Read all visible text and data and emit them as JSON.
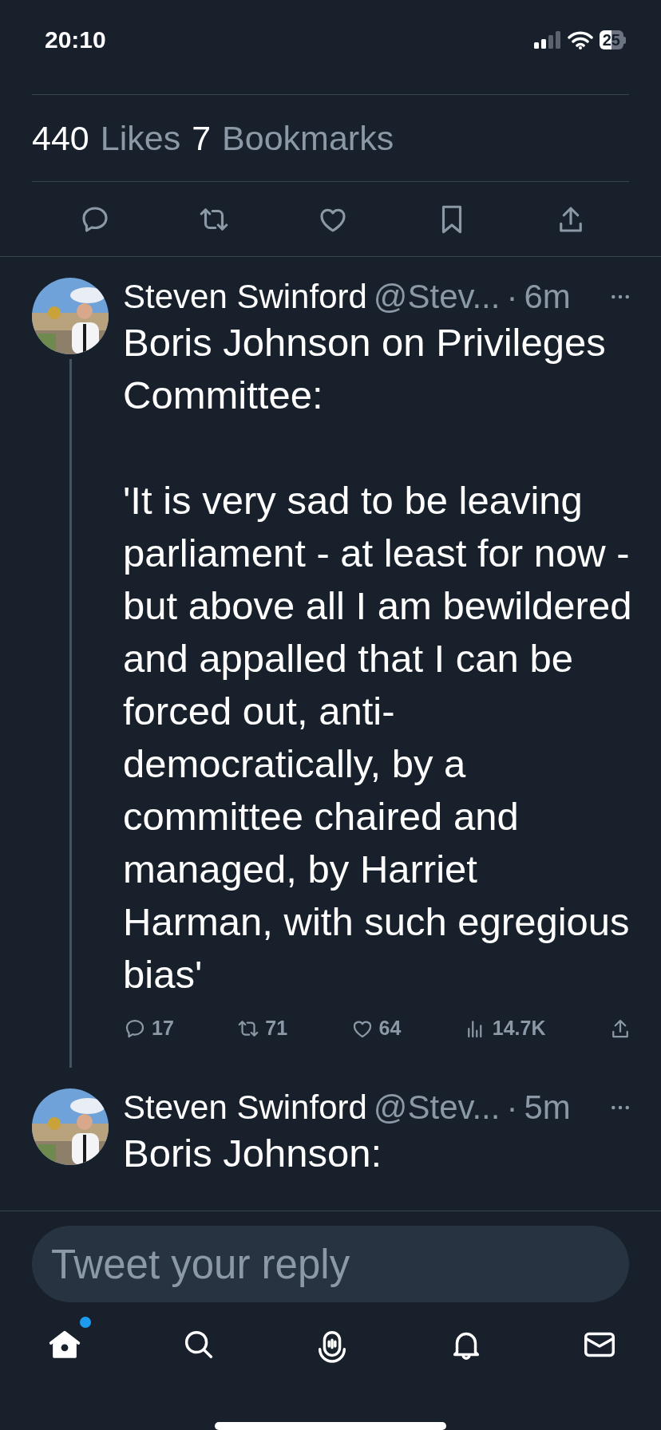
{
  "status_bar": {
    "time": "20:10",
    "battery": "25"
  },
  "stats": [
    {
      "count": "440",
      "label": "Likes"
    },
    {
      "count": "7",
      "label": "Bookmarks"
    }
  ],
  "tweets": [
    {
      "name": "Steven Swinford",
      "handle": "@Stev...",
      "separator": "·",
      "time": "6m",
      "thread_line": true,
      "body": "Boris Johnson on Privileges Committee:\n\n'It is very sad to be leaving parliament - at least for now - but above all I am bewildered and appalled that I can be forced out, anti-democratically, by a committee chaired and managed, by Harriet Harman, with such egregious bias'",
      "counts": [
        "17",
        "71",
        "64",
        "14.7K"
      ]
    },
    {
      "name": "Steven Swinford",
      "handle": "@Stev...",
      "separator": "·",
      "time": "5m",
      "thread_line": false,
      "body": "Boris Johnson:"
    }
  ],
  "reply": {
    "placeholder": "Tweet your reply"
  },
  "nav": [
    {
      "selected": true,
      "dot": true
    },
    {
      "selected": false,
      "dot": false
    },
    {
      "selected": false,
      "dot": false
    },
    {
      "selected": false,
      "dot": false
    },
    {
      "selected": false,
      "dot": false
    }
  ]
}
